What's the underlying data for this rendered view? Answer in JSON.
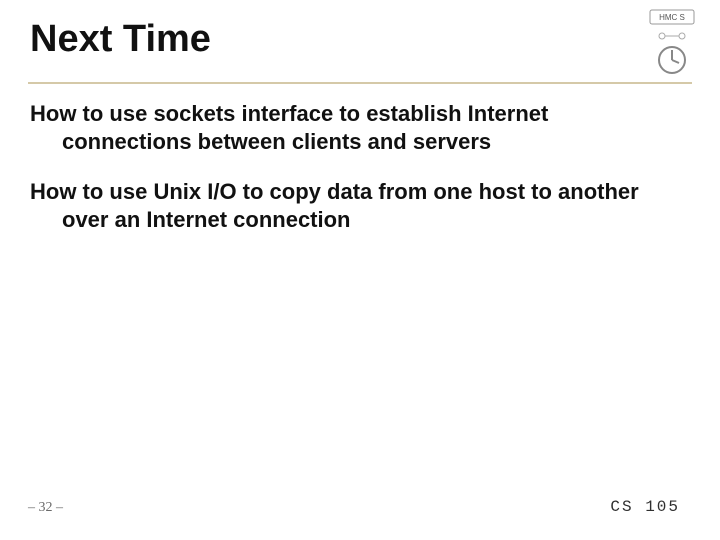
{
  "title": "Next Time",
  "bullets": [
    "How to use sockets interface to establish Internet connections between clients and servers",
    "How to use Unix I/O to copy data from one host to another over an Internet connection"
  ],
  "page_number": "– 32 –",
  "course_code": "CS 105",
  "logo_text": "HMC S"
}
